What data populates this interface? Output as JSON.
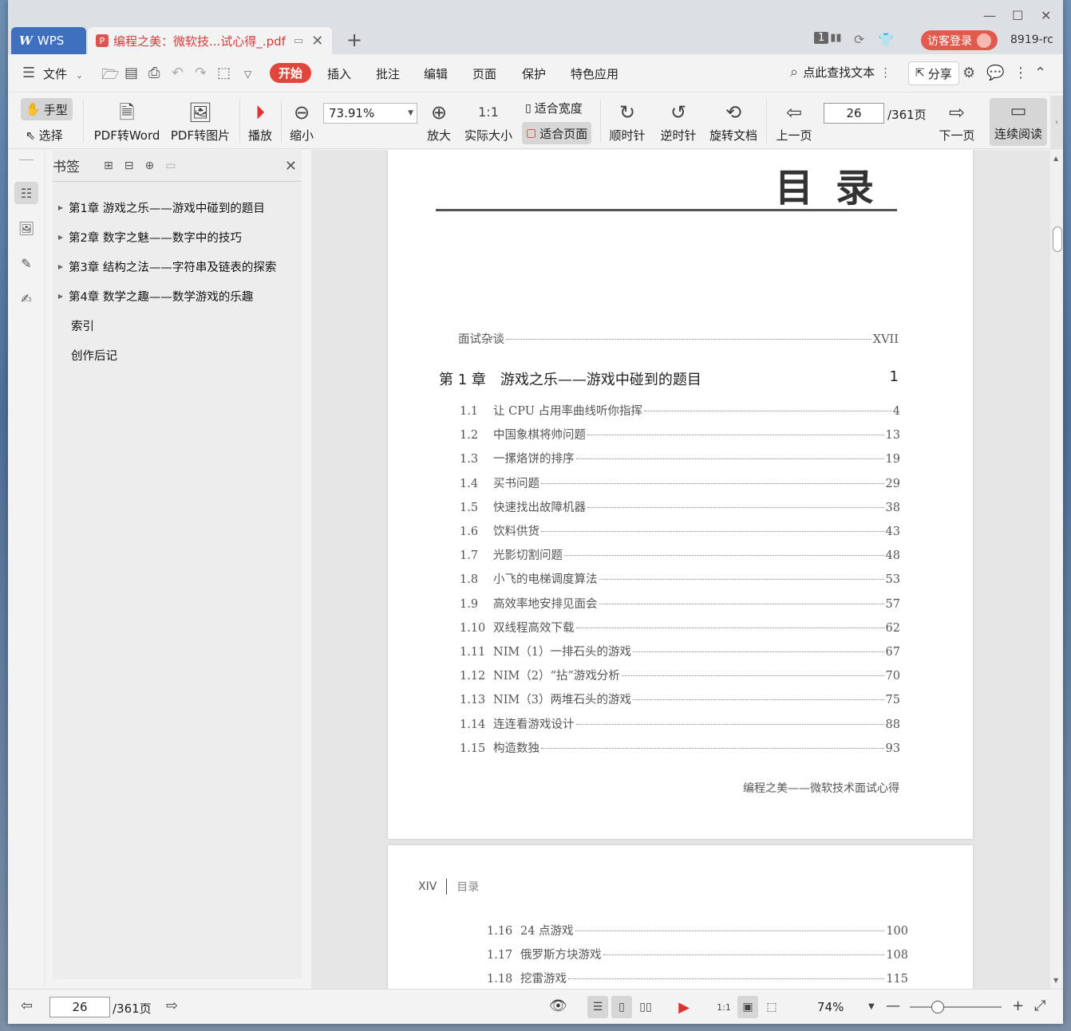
{
  "titlebar": {
    "app_tab": "WPS",
    "doc_tab": "编程之美：微软技...试心得_.pdf",
    "badge_count": "1",
    "visitor_login": "访客登录",
    "user_id": "8919-rc"
  },
  "menubar": {
    "file": "文件",
    "tabs": [
      "开始",
      "插入",
      "批注",
      "编辑",
      "页面",
      "保护",
      "特色应用"
    ],
    "search_text": "点此查找文本",
    "share": "分享"
  },
  "toolbar": {
    "hand": "手型",
    "select": "选择",
    "pdf_to_word": "PDF转Word",
    "pdf_to_image": "PDF转图片",
    "play": "播放",
    "zoom_out": "缩小",
    "zoom_value": "73.91%",
    "zoom_in": "放大",
    "actual_size": "实际大小",
    "fit_width": "适合宽度",
    "fit_page": "适合页面",
    "clockwise": "顺时针",
    "counterclockwise": "逆时针",
    "rotate_doc": "旋转文档",
    "prev_page": "上一页",
    "current_page": "26",
    "total_pages": "/361页",
    "next_page": "下一页",
    "continuous": "连续阅读"
  },
  "bookmarks": {
    "title": "书签",
    "items": [
      {
        "label": "第1章 游戏之乐——游戏中碰到的题目",
        "expandable": true
      },
      {
        "label": "第2章 数字之魅——数字中的技巧",
        "expandable": true
      },
      {
        "label": "第3章 结构之法——字符串及链表的探索",
        "expandable": true
      },
      {
        "label": "第4章 数学之趣——数学游戏的乐趣",
        "expandable": true
      },
      {
        "label": "索引",
        "expandable": false
      },
      {
        "label": "创作后记",
        "expandable": false
      }
    ]
  },
  "page1": {
    "title": "目录",
    "preface": {
      "title": "面试杂谈",
      "page": "XVII"
    },
    "chapter": {
      "title": "第 1 章　游戏之乐——游戏中碰到的题目",
      "page": "1"
    },
    "entries": [
      {
        "num": "1.1",
        "title": "让 CPU 占用率曲线听你指挥",
        "page": "4"
      },
      {
        "num": "1.2",
        "title": "中国象棋将帅问题",
        "page": "13"
      },
      {
        "num": "1.3",
        "title": "一摞烙饼的排序",
        "page": "19"
      },
      {
        "num": "1.4",
        "title": "买书问题",
        "page": "29"
      },
      {
        "num": "1.5",
        "title": "快速找出故障机器",
        "page": "38"
      },
      {
        "num": "1.6",
        "title": "饮料供货",
        "page": "43"
      },
      {
        "num": "1.7",
        "title": "光影切割问题",
        "page": "48"
      },
      {
        "num": "1.8",
        "title": "小飞的电梯调度算法",
        "page": "53"
      },
      {
        "num": "1.9",
        "title": "高效率地安排见面会",
        "page": "57"
      },
      {
        "num": "1.10",
        "title": "双线程高效下载",
        "page": "62"
      },
      {
        "num": "1.11",
        "title": "NIM（1）一排石头的游戏",
        "page": "67"
      },
      {
        "num": "1.12",
        "title": "NIM（2）“拈”游戏分析",
        "page": "70"
      },
      {
        "num": "1.13",
        "title": "NIM（3）两堆石头的游戏",
        "page": "75"
      },
      {
        "num": "1.14",
        "title": "连连看游戏设计",
        "page": "88"
      },
      {
        "num": "1.15",
        "title": "构造数独",
        "page": "93"
      }
    ],
    "footer": "编程之美——微软技术面试心得"
  },
  "page2": {
    "page_num": "XIV",
    "section": "目录",
    "entries": [
      {
        "num": "1.16",
        "title": "24 点游戏",
        "page": "100"
      },
      {
        "num": "1.17",
        "title": "俄罗斯方块游戏",
        "page": "108"
      },
      {
        "num": "1.18",
        "title": "挖雷游戏",
        "page": "115"
      }
    ]
  },
  "statusbar": {
    "current_page": "26",
    "total_pages": "/361页",
    "zoom": "74%",
    "zoom_fraction": 0.3
  }
}
